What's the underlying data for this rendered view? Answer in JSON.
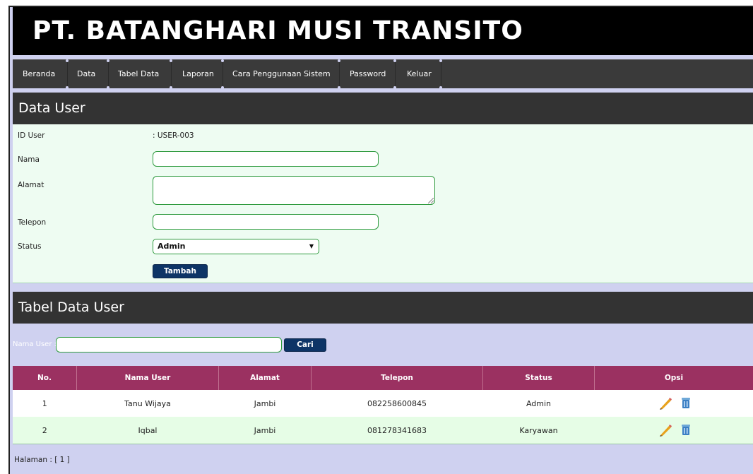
{
  "app": {
    "title": "PT. BATANGHARI MUSI TRANSITO"
  },
  "nav": {
    "items": [
      {
        "label": "Beranda"
      },
      {
        "label": "Data"
      },
      {
        "label": "Tabel Data"
      },
      {
        "label": "Laporan"
      },
      {
        "label": "Cara Penggunaan Sistem"
      },
      {
        "label": "Password"
      },
      {
        "label": "Keluar"
      }
    ]
  },
  "form": {
    "heading": "Data User",
    "id_label": "ID User",
    "id_value": ": USER-003",
    "nama_label": "Nama",
    "nama_value": "",
    "alamat_label": "Alamat",
    "alamat_value": "",
    "telepon_label": "Telepon",
    "telepon_value": "",
    "status_label": "Status",
    "status_selected": "Admin",
    "submit_label": "Tambah"
  },
  "table_section": {
    "heading": "Tabel Data User",
    "search_label": "Nama User :",
    "search_value": "",
    "search_button": "Cari",
    "columns": [
      "No.",
      "Nama User",
      "Alamat",
      "Telepon",
      "Status",
      "Opsi"
    ],
    "rows": [
      {
        "no": "1",
        "nama": "Tanu Wijaya",
        "alamat": "Jambi",
        "telepon": "082258600845",
        "status": "Admin"
      },
      {
        "no": "2",
        "nama": "Iqbal",
        "alamat": "Jambi",
        "telepon": "081278341683",
        "status": "Karyawan"
      }
    ],
    "row_icons": [
      "pencil-icon",
      "trash-icon"
    ],
    "pager": "Halaman : [ 1 ]"
  },
  "colors": {
    "header_bg": "#000000",
    "nav_bg": "#3a3a3a",
    "page_bg": "#cfd1f0",
    "form_bg": "#eefcf2",
    "table_header_bg": "#9b3161",
    "button_bg": "#0d3466",
    "input_border": "#2e9a3e"
  }
}
